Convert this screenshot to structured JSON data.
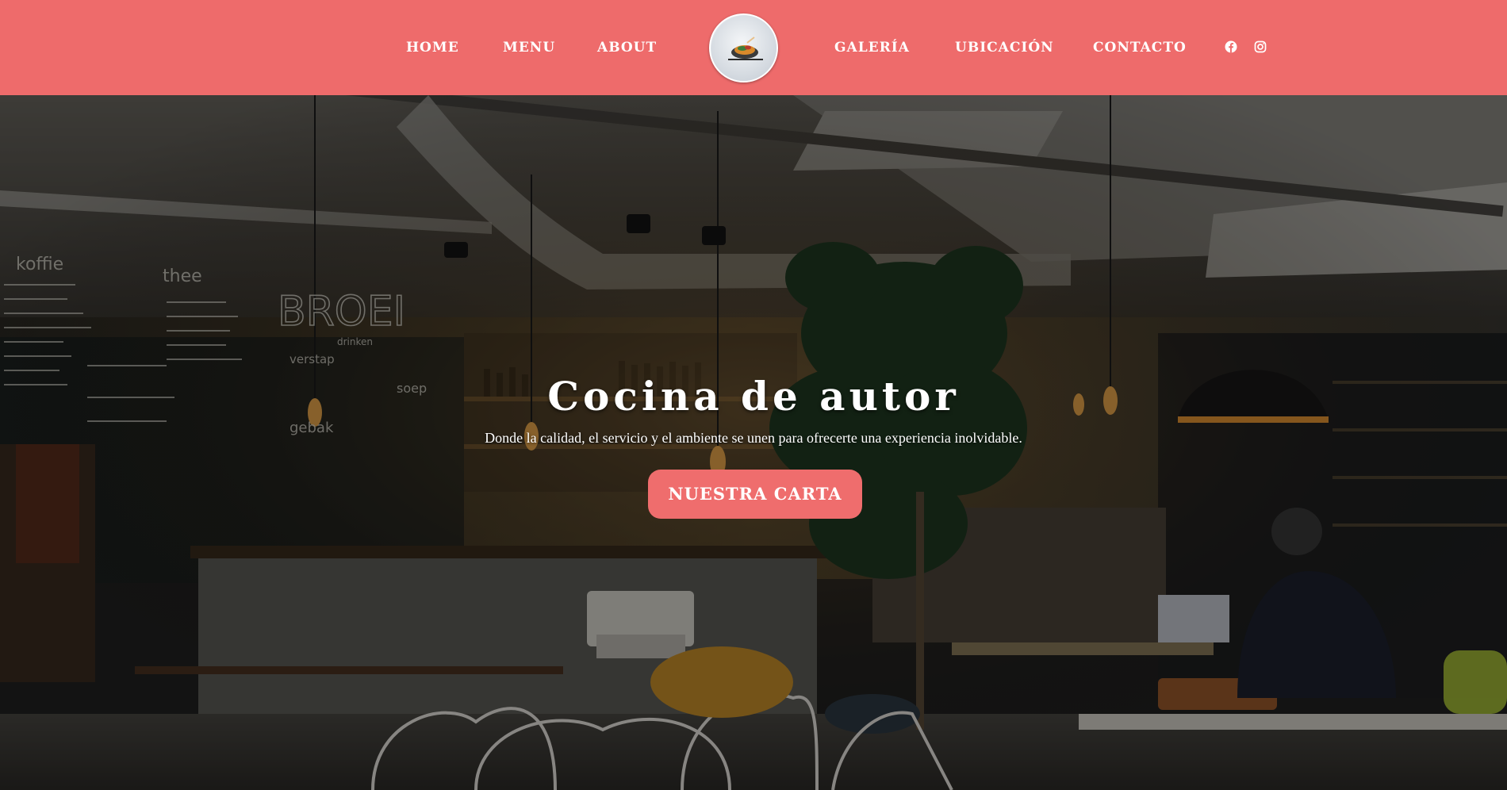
{
  "header": {
    "background_color": "#ee6b6b",
    "nav": {
      "home": "HOME",
      "menu": "MENU",
      "about": "ABOUT",
      "galeria": "GALERÍA",
      "ubicacion": "UBICACIÓN",
      "contacto": "CONTACTO"
    },
    "logo_icon": "dish-plate-icon",
    "social": {
      "facebook_icon": "facebook-icon",
      "instagram_icon": "instagram-icon"
    }
  },
  "hero": {
    "title": "Cocina de autor",
    "subtitle": "Donde la calidad, el servicio y el ambiente se unen para ofrecerte una experiencia inolvidable.",
    "cta_label": "NUESTRA CARTA",
    "cta_color": "#ef6d6d",
    "background_image": "cafe-interior-photo",
    "chalkboard": {
      "heading_1": "koffie",
      "heading_2": "thee",
      "brand": "BROEI",
      "brand_sub": "drinken",
      "section_gebak": "gebak",
      "section_soep": "soep",
      "section_verstap": "verstap"
    }
  }
}
